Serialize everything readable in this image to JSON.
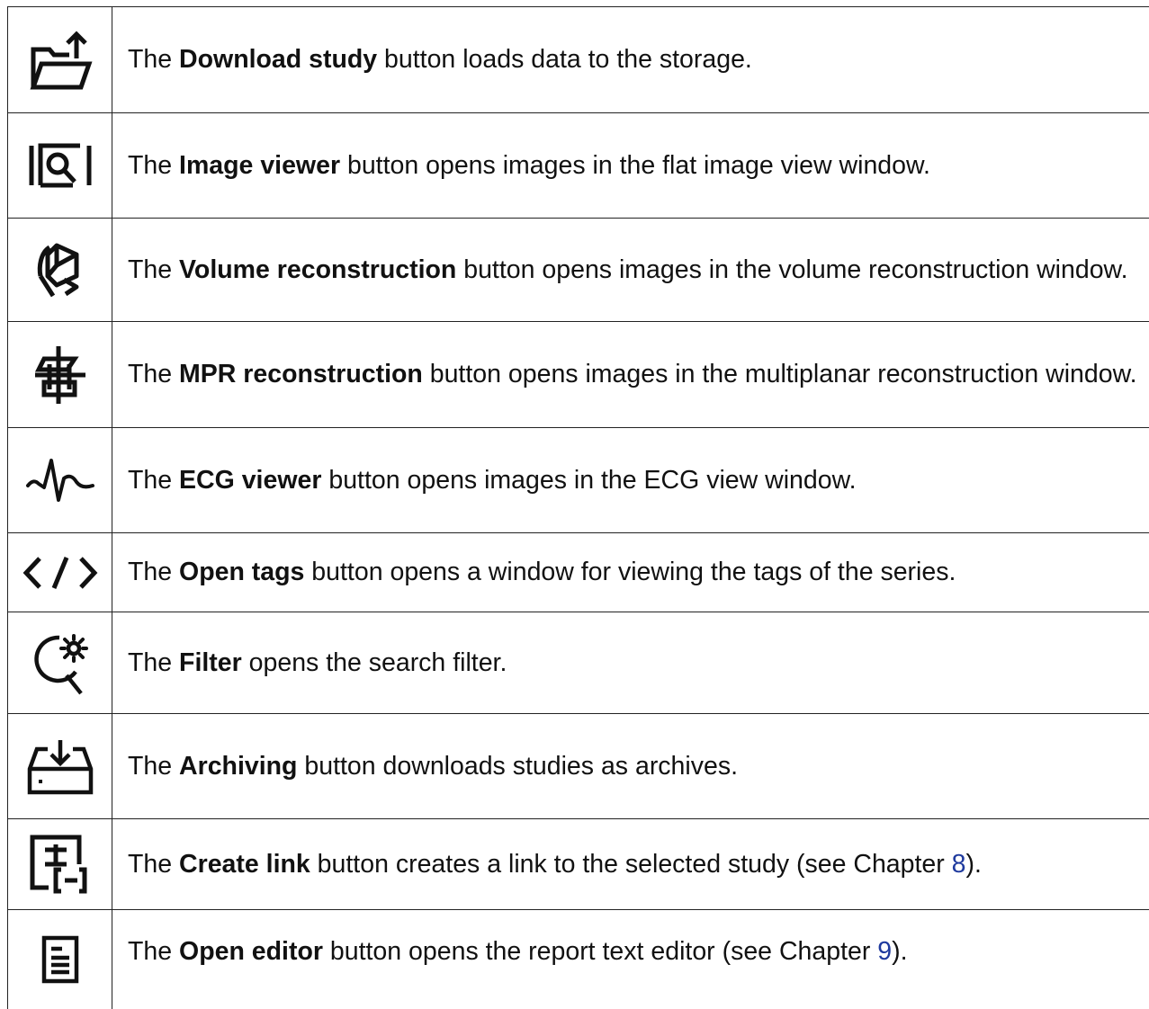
{
  "rows": [
    {
      "icon": "download-study-icon",
      "prefix": "The ",
      "bold": "Download study",
      "suffix": " button loads data to the storage."
    },
    {
      "icon": "image-viewer-icon",
      "prefix": "The ",
      "bold": "Image viewer",
      "suffix": " button opens images in the flat image view window."
    },
    {
      "icon": "volume-reconstruction-icon",
      "prefix": "The ",
      "bold": "Volume reconstruction",
      "suffix": " button opens images in the volume reconstruction window."
    },
    {
      "icon": "mpr-reconstruction-icon",
      "prefix": "The ",
      "bold": "MPR reconstruction",
      "suffix": " button opens images in the multiplanar reconstruction window."
    },
    {
      "icon": "ecg-viewer-icon",
      "prefix": "The ",
      "bold": "ECG viewer",
      "suffix": " button opens images in the ECG view window."
    },
    {
      "icon": "open-tags-icon",
      "prefix": "The ",
      "bold": "Open tags",
      "suffix": " button opens a window for viewing the tags of the series."
    },
    {
      "icon": "filter-icon",
      "prefix": "The ",
      "bold": "Filter",
      "suffix": " opens the search filter."
    },
    {
      "icon": "archiving-icon",
      "prefix": "The ",
      "bold": "Archiving",
      "suffix": " button downloads studies as archives."
    },
    {
      "icon": "create-link-icon",
      "prefix": "The ",
      "bold": "Create link",
      "suffix": " button creates a link to the selected study (see Chapter ",
      "ref": "8",
      "end": ")."
    },
    {
      "icon": "open-editor-icon",
      "prefix": "The ",
      "bold": "Open editor",
      "suffix": " button opens the report text editor (see Chapter ",
      "ref": "9",
      "end": ")."
    }
  ],
  "colors": {
    "text": "#111111",
    "border": "#222222",
    "link": "#1f3a9e"
  }
}
